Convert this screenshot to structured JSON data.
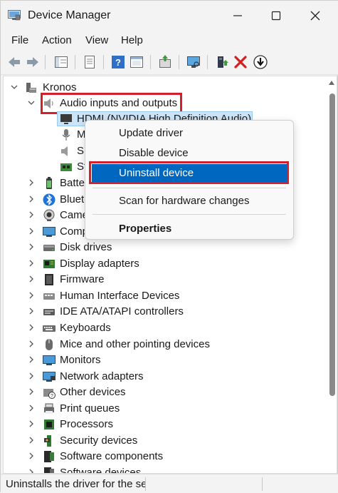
{
  "window": {
    "title": "Device Manager"
  },
  "menu": {
    "items": [
      "File",
      "Action",
      "View",
      "Help"
    ]
  },
  "tree": {
    "root": "Kronos",
    "expanded_category": "Audio inputs and outputs",
    "audio_children": [
      "HDMI (NVIDIA High Definition Audio)",
      "M",
      "Sp",
      "St"
    ],
    "categories": [
      "Batte",
      "Blueto",
      "Came",
      "Comp",
      "Disk drives",
      "Display adapters",
      "Firmware",
      "Human Interface Devices",
      "IDE ATA/ATAPI controllers",
      "Keyboards",
      "Mice and other pointing devices",
      "Monitors",
      "Network adapters",
      "Other devices",
      "Print queues",
      "Processors",
      "Security devices",
      "Software components",
      "Software devices"
    ]
  },
  "context_menu": {
    "update": "Update driver",
    "disable": "Disable device",
    "uninstall": "Uninstall device",
    "scan": "Scan for hardware changes",
    "properties": "Properties"
  },
  "status": {
    "text": "Uninstalls the driver for the se"
  },
  "colors": {
    "highlight_box": "#d4202c",
    "menu_selection": "#0067c0",
    "row_selection": "#cce4f7"
  }
}
